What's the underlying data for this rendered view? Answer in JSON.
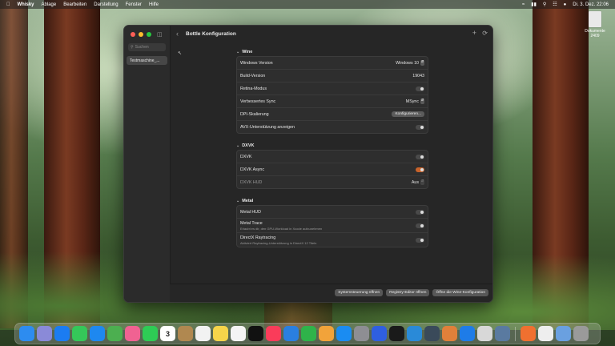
{
  "menubar": {
    "app": "Whisky",
    "items": [
      "Ablage",
      "Bearbeiten",
      "Darstellung",
      "Fenster",
      "Hilfe"
    ],
    "clock": "Di. 3. Dez.  22:06"
  },
  "desktop": {
    "file_label": "Dokumente 2409"
  },
  "sidebar": {
    "search_placeholder": "Suchen",
    "items": [
      {
        "label": "Testmaschine_..."
      }
    ]
  },
  "toolbar": {
    "title": "Bottle Konfiguration"
  },
  "sections": {
    "wine": {
      "title": "Wine",
      "windows_version": {
        "label": "Windows Version",
        "value": "Windows 10"
      },
      "build_version": {
        "label": "Build-Version",
        "value": "19043"
      },
      "retina": {
        "label": "Retina-Modus"
      },
      "sync": {
        "label": "Verbessertes Sync",
        "value": "MSync"
      },
      "dpi": {
        "label": "DPI-Skalierung",
        "button": "Konfigurieren..."
      },
      "avx": {
        "label": "AVX-Unterstützung anzeigen"
      }
    },
    "dxvk": {
      "title": "DXVK",
      "dxvk": {
        "label": "DXVK"
      },
      "async": {
        "label": "DXVK Async"
      },
      "hud": {
        "label": "DXVK HUD",
        "value": "Aus"
      }
    },
    "metal": {
      "title": "Metal",
      "hud": {
        "label": "Metal HUD"
      },
      "trace": {
        "label": "Metal Trace",
        "sub": "Erlaubt es dir, den GPU-Workload in Xcode aufzunehmen"
      },
      "raytracing": {
        "label": "DirectX Raytracing",
        "sub": "Aktiviert Raytracing-Unterstützung in DirectX 12 Titeln"
      }
    }
  },
  "footer": {
    "buttons": [
      "Systemsteuerung öffnen",
      "Registry-Editor öffnen",
      "Öffne die Wine-Konfiguration"
    ]
  },
  "colors": {
    "accent": "#c8632b",
    "window_bg": "#262626"
  },
  "dock": {
    "calendar_day": "3",
    "apps": [
      {
        "icon": "finder-icon",
        "color": "#2d8cf0"
      },
      {
        "icon": "launchpad-icon",
        "color": "#8a8ad8"
      },
      {
        "icon": "safari-icon",
        "color": "#1b7cf2"
      },
      {
        "icon": "messages-icon",
        "color": "#35c759"
      },
      {
        "icon": "mail-icon",
        "color": "#1e88f0"
      },
      {
        "icon": "maps-icon",
        "color": "#4caf50"
      },
      {
        "icon": "photos-icon",
        "color": "#f06292"
      },
      {
        "icon": "facetime-icon",
        "color": "#2ecc55"
      },
      {
        "icon": "calendar-icon",
        "color": "#ffffff"
      },
      {
        "icon": "contacts-icon",
        "color": "#b08850"
      },
      {
        "icon": "reminders-icon",
        "color": "#f2f2f2"
      },
      {
        "icon": "notes-icon",
        "color": "#f6d44a"
      },
      {
        "icon": "freeform-icon",
        "color": "#f4f4f4"
      },
      {
        "icon": "tv-icon",
        "color": "#111111"
      },
      {
        "icon": "music-icon",
        "color": "#fa3c5a"
      },
      {
        "icon": "keynote-icon",
        "color": "#2a7fe0"
      },
      {
        "icon": "numbers-icon",
        "color": "#2fb34a"
      },
      {
        "icon": "pages-icon",
        "color": "#f2a33a"
      },
      {
        "icon": "appstore-icon",
        "color": "#1a8cf2"
      },
      {
        "icon": "settings-icon",
        "color": "#8e8e93"
      },
      {
        "icon": "cube-icon",
        "color": "#2f5fe0"
      },
      {
        "icon": "xcode-like-icon",
        "color": "#1a1a1a"
      },
      {
        "icon": "whale-icon",
        "color": "#2a8ad8"
      },
      {
        "icon": "steam-icon",
        "color": "#3a4a5a"
      },
      {
        "icon": "whisky-icon",
        "color": "#e0803a"
      },
      {
        "icon": "xcode-icon",
        "color": "#1e7ce8"
      },
      {
        "icon": "script-icon",
        "color": "#d8d8d8"
      },
      {
        "icon": "robot-icon",
        "color": "#5a7aa0"
      },
      {
        "icon": "crossover-icon",
        "color": "#f07030"
      },
      {
        "icon": "file-icon",
        "color": "#eeeeee"
      },
      {
        "icon": "folder-icon",
        "color": "#6aa0e0"
      },
      {
        "icon": "trash-icon",
        "color": "#9a9a9a"
      }
    ]
  }
}
